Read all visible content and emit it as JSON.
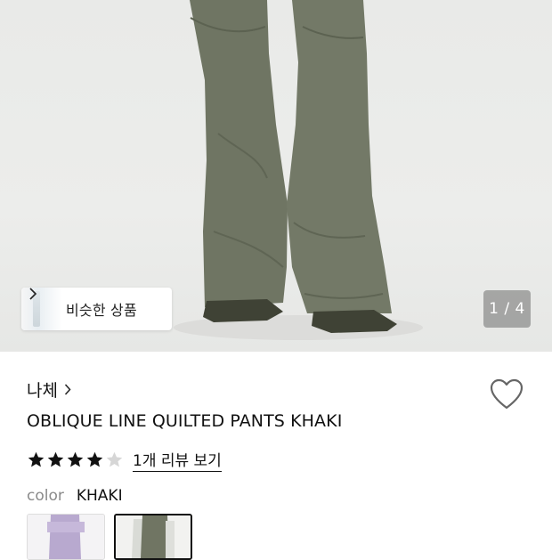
{
  "gallery": {
    "similar_products_label": "비슷한 상품",
    "page_counter": "1 / 4"
  },
  "product": {
    "brand": "나체",
    "title": "OBLIQUE LINE QUILTED PANTS KHAKI",
    "rating": 4,
    "rating_max": 5,
    "reviews_link": "1개 리뷰 보기",
    "color_label": "color",
    "color_value": "KHAKI",
    "swatches": [
      {
        "name": "lavender",
        "color": "#b8a9cf"
      },
      {
        "name": "khaki",
        "color": "#707563"
      }
    ]
  },
  "colors": {
    "pants": "#6f7563",
    "shoes": "#3f4235",
    "star_on": "#111111",
    "star_off": "#d6d6d6"
  },
  "icons": [
    "chevron-right-icon",
    "heart-icon",
    "star-icon"
  ]
}
